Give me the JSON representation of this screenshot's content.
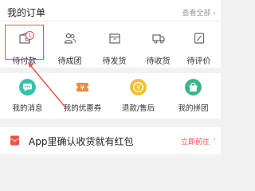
{
  "orders": {
    "title": "我的订单",
    "view_all": "查看全部",
    "items": [
      {
        "label": "待付款",
        "badge": "1",
        "icon": "wallet-icon"
      },
      {
        "label": "待成团",
        "icon": "group-icon"
      },
      {
        "label": "待发货",
        "icon": "box-icon"
      },
      {
        "label": "待收货",
        "icon": "truck-icon"
      },
      {
        "label": "待评价",
        "icon": "review-icon"
      }
    ]
  },
  "services": [
    {
      "label": "我的消息",
      "icon": "message-icon",
      "color": "#35c2a8"
    },
    {
      "label": "我的优惠券",
      "icon": "coupon-icon",
      "color": "#f08a3a"
    },
    {
      "label": "退款/售后",
      "icon": "refund-icon",
      "color": "#f3bf2d"
    },
    {
      "label": "我的拼团",
      "icon": "group-buy-icon",
      "color": "#35b98c"
    }
  ],
  "promo": {
    "text": "App里确认收货就有红包",
    "link": "立即前往",
    "icon": "red-envelope-icon",
    "accent": "#e4574e"
  },
  "colors": {
    "accent": "#e4574e",
    "background": "#f2f2f2"
  }
}
